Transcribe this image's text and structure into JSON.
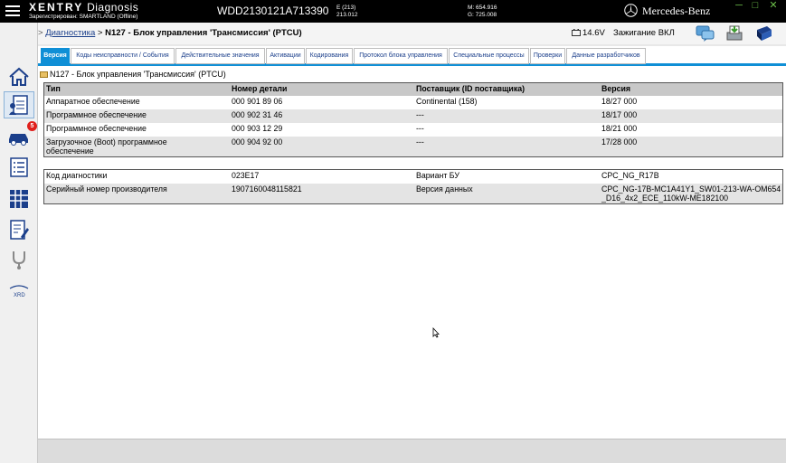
{
  "titlebar": {
    "brand_bold": "XENTRY",
    "brand_rest": " Diagnosis",
    "registered": "Зарегистрирован: SMARTLAND (Offline)",
    "vin": "WDD2130121A713390",
    "ecode_1": "E (213)",
    "ecode_2": "213.012",
    "m_code": "M: 654.916",
    "g_code": "G: 725.008",
    "maker": "Mercedes-Benz"
  },
  "header": {
    "crumb_link": "Диагностика",
    "crumb_sep": " > ",
    "crumb_current": "N127 - Блок управления 'Трансмиссия' (PTCU)",
    "battery": "14.6V",
    "ignition": "Зажигание ВКЛ"
  },
  "leftbar": {
    "badge_count": "5",
    "xrd_label": "XRD"
  },
  "tabs": [
    {
      "label": "Версия"
    },
    {
      "label": "Коды неисправности / События"
    },
    {
      "label": "Действительные значения"
    },
    {
      "label": "Активации"
    },
    {
      "label": "Кодирования"
    },
    {
      "label": "Протокол блока управления"
    },
    {
      "label": "Специальные процессы"
    },
    {
      "label": "Проверки"
    },
    {
      "label": "Данные разработчиков"
    }
  ],
  "section_title": "N127 - Блок управления 'Трансмиссия' (PTCU)",
  "version_table": {
    "headers": [
      "Тип",
      "Номер детали",
      "Поставщик (ID поставщика)",
      "Версия"
    ],
    "rows": [
      [
        "Аппаратное обеспечение",
        "000 901 89 06",
        "Continental (158)",
        "18/27 000"
      ],
      [
        "Программное обеспечение",
        "000 902 31 46",
        "---",
        "18/17 000"
      ],
      [
        "Программное обеспечение",
        "000 903 12 29",
        "---",
        "18/21 000"
      ],
      [
        "Загрузочное (Boot) программное обеспечение",
        "000 904 92 00",
        "---",
        "17/28 000"
      ]
    ]
  },
  "diag_table": {
    "rows": [
      [
        "Код диагностики",
        "023E17",
        "Вариант БУ",
        "CPC_NG_R17B"
      ],
      [
        "Серийный номер производителя",
        "1907160048115821",
        "Версия данных",
        "CPC_NG-17B-MC1A41Y1_SW01-213-WA-OM654_D16_4x2_ECE_110kW-ME182100"
      ]
    ]
  }
}
